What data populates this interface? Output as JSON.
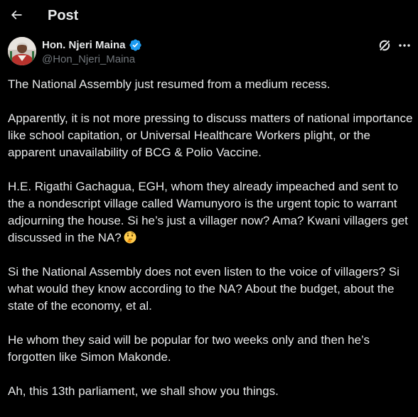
{
  "header": {
    "title": "Post",
    "back_icon": "arrow-left-icon"
  },
  "author": {
    "display_name": "Hon. Njeri Maina",
    "handle": "@Hon_Njeri_Maina",
    "verified": true,
    "verified_color": "#1d9bf0"
  },
  "post": {
    "paragraphs": [
      "The National Assembly just resumed from a medium recess.",
      "Apparently, it is not more pressing to discuss matters of national importance like school capitation, or Universal Healthcare Workers plight, or the apparent unavailability of BCG & Polio Vaccine.",
      "H.E. Rigathi Gachagua, EGH, whom they already impeached and sent to the a nondescript village called Wamunyoro is the urgent topic to warrant adjourning the house. Si he’s just a villager now? Ama? Kwani villagers get discussed in the NA?",
      "Si the National Assembly does not even listen to the voice of villagers? Si what would they know according to the NA? About the budget, about the state of the economy, et al.",
      "He whom they said will be popular for two weeks only and then he’s forgotten like Simon Makonde.",
      "Ah, this 13th parliament, we shall show you things."
    ],
    "emoji": "thinking-face-icon"
  },
  "colors": {
    "background": "#000000",
    "text_primary": "#e7e9ea",
    "text_secondary": "#71767b",
    "accent": "#1d9bf0"
  }
}
